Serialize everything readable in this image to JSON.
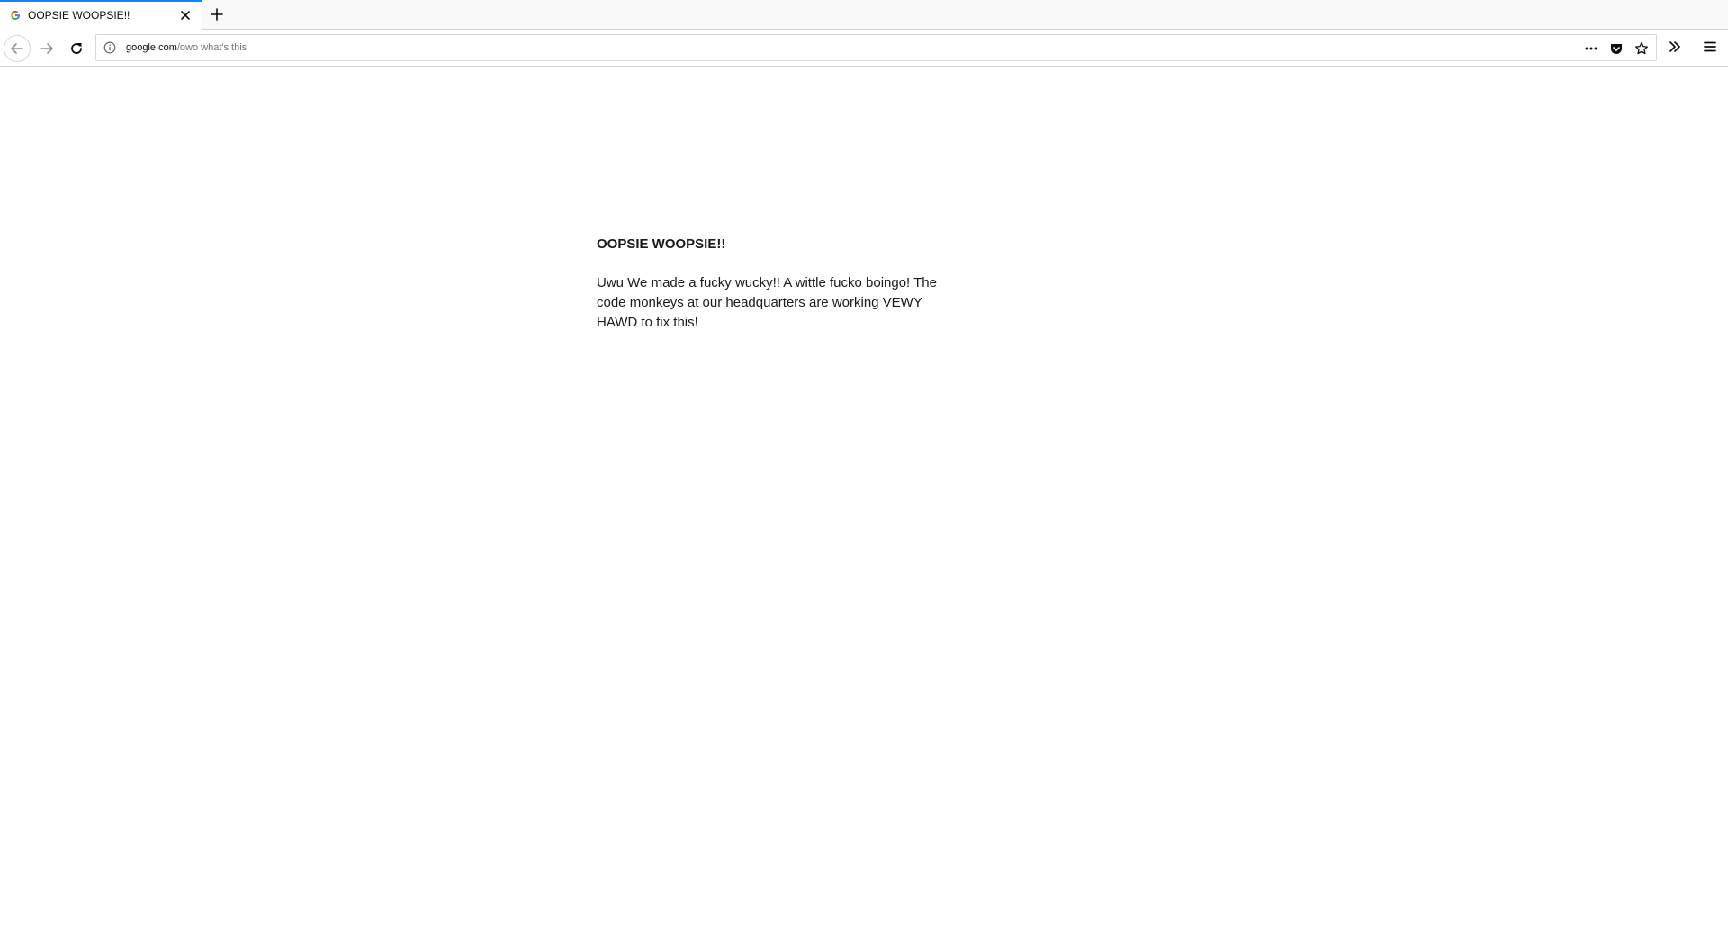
{
  "tab": {
    "title": "OOPSIE WOOPSIE!!",
    "favicon": "google-g-icon"
  },
  "toolbar": {
    "url_domain": "google.com",
    "url_path": "/owo what's this"
  },
  "page": {
    "heading": "OOPSIE WOOPSIE!!",
    "body": "Uwu We made a fucky wucky!! A wittle fucko boingo! The code monkeys at our headquarters are working VEWY HAWD to fix this!"
  },
  "colors": {
    "accent": "#0a84ff",
    "text": "#1a1a1a"
  }
}
